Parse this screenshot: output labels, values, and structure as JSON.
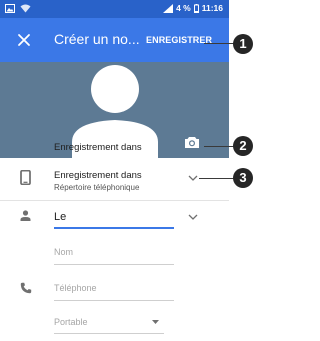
{
  "status_bar": {
    "battery_percent": "4 %",
    "time": "11:16"
  },
  "app_bar": {
    "close_icon": "close-icon",
    "title": "Créer un no...",
    "save_label": "ENREGISTRER"
  },
  "photo": {
    "avatar_icon": "person-silhouette-icon",
    "camera_icon": "camera-icon"
  },
  "form": {
    "save_in": {
      "label": "Enregistrement dans",
      "value": "Répertoire téléphonique"
    },
    "name_field": {
      "value": "Le",
      "last_name_placeholder": "Nom"
    },
    "phone_field": {
      "placeholder": "Téléphone",
      "type_placeholder": "Portable"
    }
  },
  "callouts": [
    "1",
    "2",
    "3"
  ],
  "colors": {
    "status_bar": "#2962c9",
    "app_bar": "#3b78e7",
    "photo_bg": "#5d7a94",
    "accent": "#3b78e7"
  }
}
